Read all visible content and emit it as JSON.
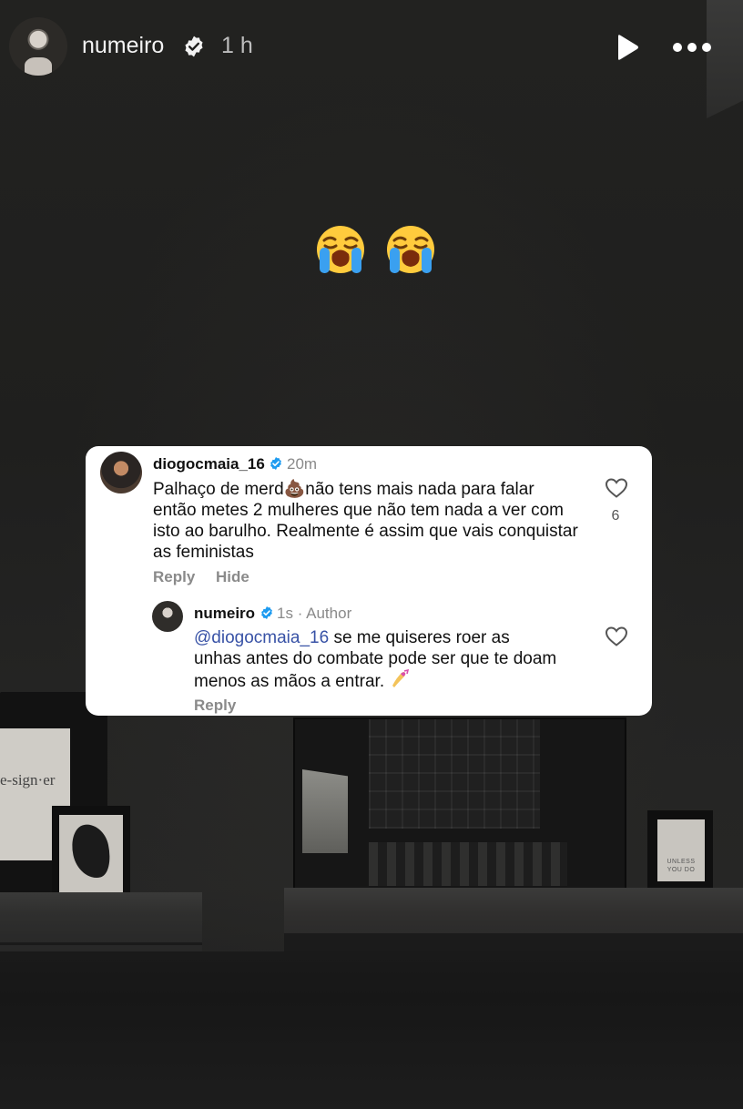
{
  "story": {
    "username": "numeiro",
    "time_ago": "1 h",
    "sticker_emojis": [
      "😭",
      "😭"
    ]
  },
  "background": {
    "poster_left_text": "e-sign·er",
    "poster_right_text": "UNLESS YOU DO"
  },
  "comment": {
    "username": "diogocmaia_16",
    "time": "20m",
    "text": "Palhaço de merd💩não tens mais nada para falar então metes 2 mulheres que não tem nada a ver com isto ao barulho. Realmente é assim que vais conquistar as feministas",
    "likes": "6",
    "reply_label": "Reply",
    "hide_label": "Hide"
  },
  "reply": {
    "username": "numeiro",
    "time": "1s",
    "author_label": "Author",
    "mention": "@diogocmaia_16",
    "text": " se me quiseres roer as unhas antes do combate pode ser que te doam menos as mãos a entrar.",
    "emoji": "💅",
    "reply_label": "Reply"
  },
  "colors": {
    "verified": "#1d9bf0",
    "mention": "#3852a6",
    "muted": "#8a8a8a"
  }
}
